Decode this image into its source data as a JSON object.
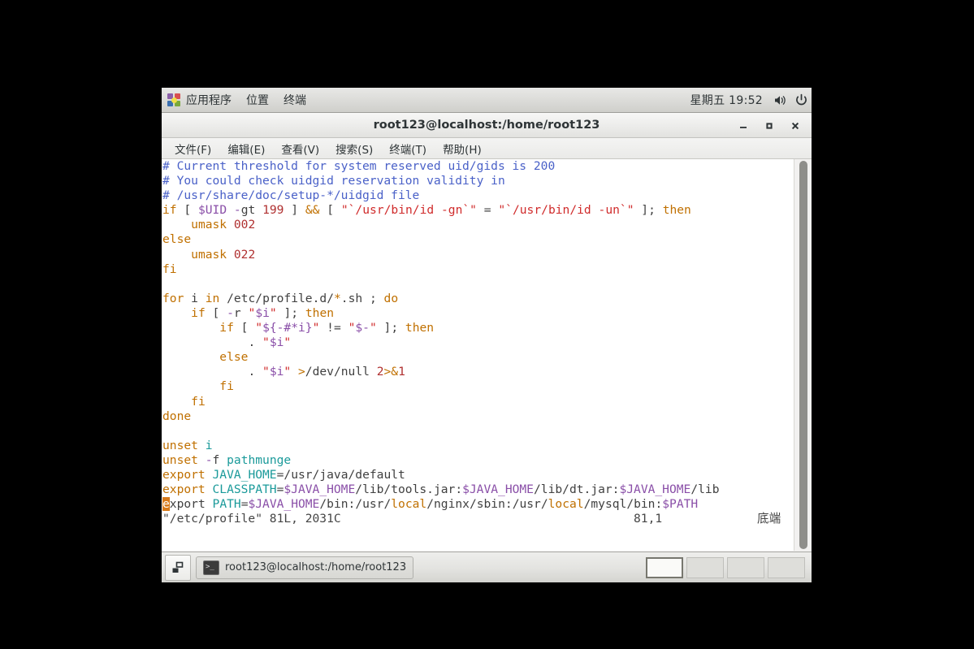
{
  "panel": {
    "apps_label": "应用程序",
    "places_label": "位置",
    "terminal_label": "终端",
    "clock": "星期五 19:52",
    "apps_icon": "gnome-applications-icon",
    "volume_icon": "volume-speaker-icon",
    "power_icon": "power-icon"
  },
  "window": {
    "title": "root123@localhost:/home/root123",
    "minimize_icon": "minimize-icon",
    "maximize_icon": "maximize-icon",
    "close_icon": "close-icon"
  },
  "menubar": {
    "items": [
      {
        "label": "文件(F)",
        "name": "menu-file"
      },
      {
        "label": "编辑(E)",
        "name": "menu-edit"
      },
      {
        "label": "查看(V)",
        "name": "menu-view"
      },
      {
        "label": "搜索(S)",
        "name": "menu-search"
      },
      {
        "label": "终端(T)",
        "name": "menu-terminal"
      },
      {
        "label": "帮助(H)",
        "name": "menu-help"
      }
    ]
  },
  "terminal": {
    "editor": "vim",
    "lines": [
      "# Current threshold for system reserved uid/gids is 200",
      "# You could check uidgid reservation validity in",
      "# /usr/share/doc/setup-*/uidgid file",
      "if [ $UID -gt 199 ] && [ \"`/usr/bin/id -gn`\" = \"`/usr/bin/id -un`\" ]; then",
      "    umask 002",
      "else",
      "    umask 022",
      "fi",
      "",
      "for i in /etc/profile.d/*.sh ; do",
      "    if [ -r \"$i\" ]; then",
      "        if [ \"${-#*i}\" != \"$-\" ]; then",
      "            . \"$i\"",
      "        else",
      "            . \"$i\" >/dev/null 2>&1",
      "        fi",
      "    fi",
      "done",
      "",
      "unset i",
      "unset -f pathmunge",
      "export JAVA_HOME=/usr/java/default",
      "export CLASSPATH=$JAVA_HOME/lib/tools.jar:$JAVA_HOME/lib/dt.jar:$JAVA_HOME/lib",
      "export PATH=$JAVA_HOME/bin:/usr/local/nginx/sbin:/usr/local/mysql/bin:$PATH"
    ],
    "status": {
      "file": "\"/etc/profile\" 81L, 2031C",
      "position": "81,1",
      "location": "底端"
    },
    "cursor": {
      "line": 24,
      "column": 1,
      "char": "e"
    },
    "colors": {
      "background": "#ffffff",
      "comment": "#4a61c8",
      "number": "#b03030",
      "string": "#d02b2b",
      "variable": "#8a4fa8",
      "keyword": "#c07000",
      "identifier": "#1a9a9a",
      "cursor": "#d87a1a"
    }
  },
  "taskbar": {
    "show_desktop_icon": "show-desktop-icon",
    "window_icon": "terminal-icon",
    "window_label": "root123@localhost:/home/root123",
    "workspaces": [
      {
        "name": "workspace-1",
        "active": true
      },
      {
        "name": "workspace-2",
        "active": false
      },
      {
        "name": "workspace-3",
        "active": false
      },
      {
        "name": "workspace-4",
        "active": false
      }
    ]
  }
}
